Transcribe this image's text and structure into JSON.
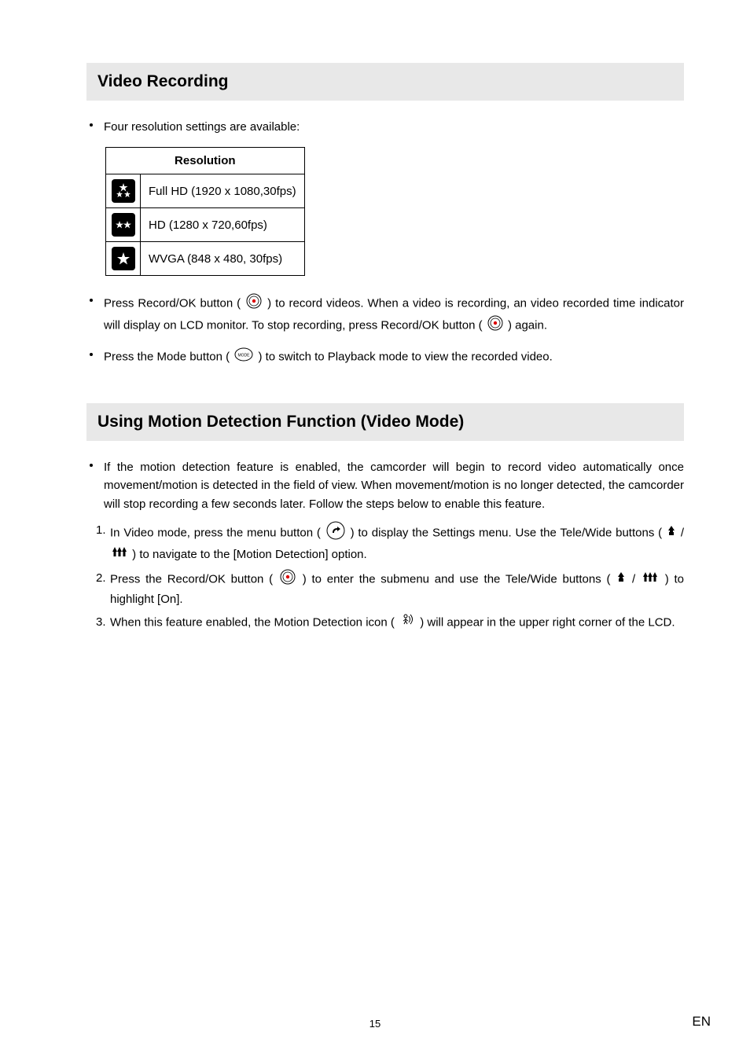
{
  "sections": {
    "video": {
      "title": "Video Recording"
    },
    "motion": {
      "title": "Using Motion Detection Function (Video Mode)"
    }
  },
  "resolution": {
    "header": "Resolution",
    "rows": [
      {
        "label": "Full HD (1920 x 1080,30fps)"
      },
      {
        "label": "HD (1280 x 720,60fps)"
      },
      {
        "label": "WVGA (848 x 480, 30fps)"
      }
    ]
  },
  "video_bullets": {
    "b0": "Four resolution settings are available:",
    "b1a": "Press Record/OK button ( ",
    "b1b": " ) to record videos. When a video is recording, an video recorded time indicator will display on LCD monitor. To stop recording, press Record/OK button ( ",
    "b1c": " ) again.",
    "b2a": "Press the Mode button ( ",
    "b2b": " ) to switch to Playback mode to view the recorded video."
  },
  "motion_intro": "If the motion detection feature is enabled, the camcorder will begin to record video automatically once movement/motion is detected in the field of view. When movement/motion is no longer detected, the camcorder will stop recording a few seconds later. Follow the steps below to enable this feature.",
  "motion_steps": {
    "s1n": "1.",
    "s1a": "In Video mode, press the menu button ( ",
    "s1b": " ) to display the Settings menu. Use the Tele/Wide buttons ( ",
    "s1c": " ) to navigate to the [Motion Detection] option.",
    "s2n": "2.",
    "s2a": "Press the Record/OK button ( ",
    "s2b": " ) to enter the submenu and use the Tele/Wide buttons ( ",
    "s2c": " ) to highlight [On].",
    "s3n": "3.",
    "s3a": "When this feature enabled, the Motion Detection icon ( ",
    "s3b": " ) will appear in the upper right corner of the LCD."
  },
  "zoom_sep": " / ",
  "footer": {
    "page": "15",
    "lang": "EN"
  }
}
